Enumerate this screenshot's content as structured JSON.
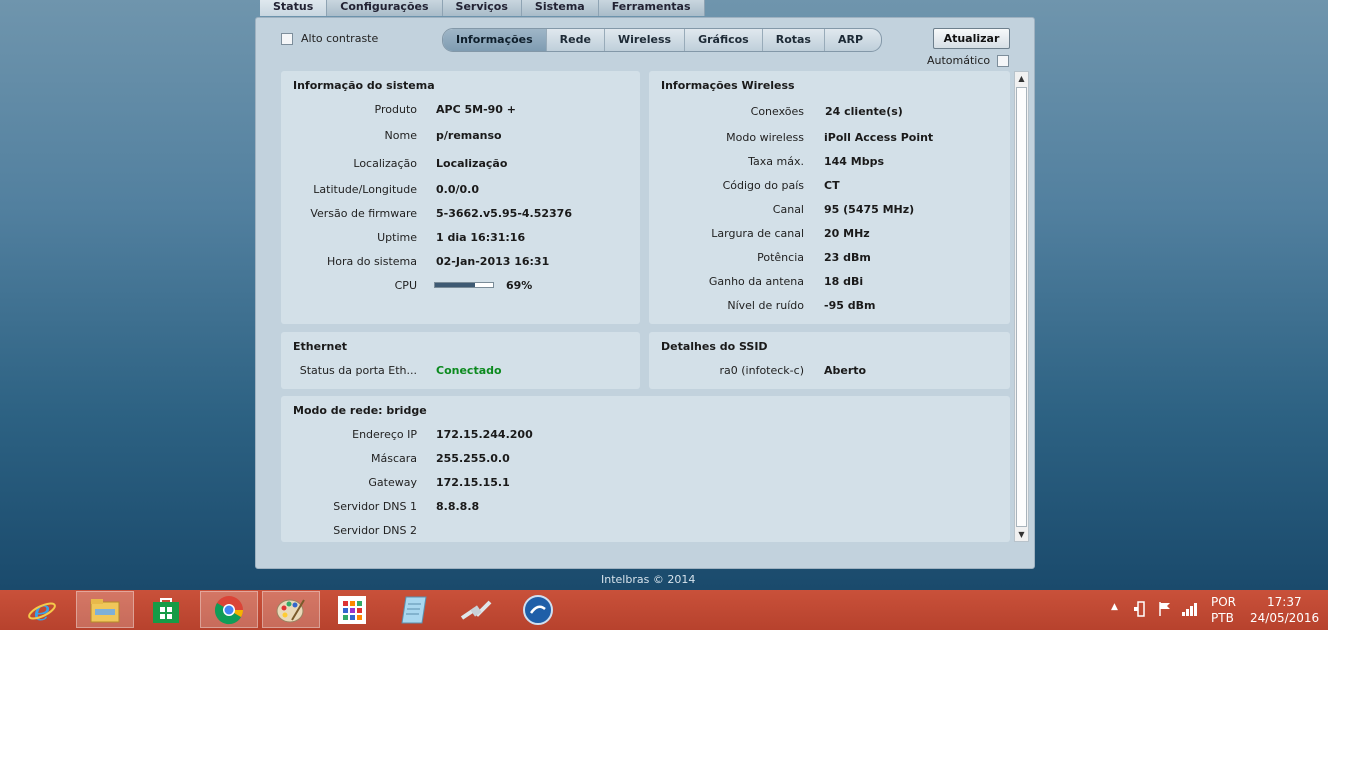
{
  "main_tabs": [
    {
      "label": "Status",
      "active": true
    },
    {
      "label": "Configurações",
      "active": false
    },
    {
      "label": "Serviços",
      "active": false
    },
    {
      "label": "Sistema",
      "active": false
    },
    {
      "label": "Ferramentas",
      "active": false
    }
  ],
  "toolbar": {
    "contrast_label": "Alto contraste",
    "update_button": "Atualizar",
    "auto_label": "Automático"
  },
  "sub_tabs": [
    {
      "label": "Informações",
      "active": true
    },
    {
      "label": "Rede",
      "active": false
    },
    {
      "label": "Wireless",
      "active": false
    },
    {
      "label": "Gráficos",
      "active": false
    },
    {
      "label": "Rotas",
      "active": false
    },
    {
      "label": "ARP",
      "active": false
    }
  ],
  "system_info": {
    "title": "Informação do sistema",
    "rows": [
      {
        "key": "Produto",
        "value": "APC 5M-90 +"
      },
      {
        "key": "Nome",
        "value": "p/remanso"
      },
      {
        "key": "Localização",
        "value": "Localização"
      },
      {
        "key": "Latitude/Longitude",
        "value": "0.0/0.0"
      },
      {
        "key": "Versão de firmware",
        "value": "5-3662.v5.95-4.52376"
      },
      {
        "key": "Uptime",
        "value": "1 dia 16:31:16"
      },
      {
        "key": "Hora do sistema",
        "value": "02-Jan-2013 16:31"
      },
      {
        "key": "CPU",
        "value": "69%"
      }
    ],
    "cpu_fraction": 0.69
  },
  "wireless_info": {
    "title": "Informações Wireless",
    "rows": [
      {
        "key": "Conexões",
        "value": "24 cliente(s)"
      },
      {
        "key": "Modo wireless",
        "value": "iPoll Access Point"
      },
      {
        "key": "Taxa máx.",
        "value": "144 Mbps"
      },
      {
        "key": "Código do país",
        "value": "CT"
      },
      {
        "key": "Canal",
        "value": "95 (5475 MHz)"
      },
      {
        "key": "Largura de canal",
        "value": "20 MHz"
      },
      {
        "key": "Potência",
        "value": "23 dBm"
      },
      {
        "key": "Ganho da antena",
        "value": "18 dBi"
      },
      {
        "key": "Nível de ruído",
        "value": "-95 dBm"
      }
    ]
  },
  "ethernet": {
    "title": "Ethernet",
    "key": "Status da porta Eth...",
    "value": "Conectado",
    "status_color": "#0c8a1f"
  },
  "ssid": {
    "title": "Detalhes do SSID",
    "key": "ra0 (infoteck-c)",
    "value": "Aberto"
  },
  "network": {
    "title": "Modo de rede: bridge",
    "rows": [
      {
        "key": "Endereço IP",
        "value": "172.15.244.200"
      },
      {
        "key": "Máscara",
        "value": "255.255.0.0"
      },
      {
        "key": "Gateway",
        "value": "172.15.15.1"
      },
      {
        "key": "Servidor DNS 1",
        "value": "8.8.8.8"
      },
      {
        "key": "Servidor DNS 2",
        "value": ""
      }
    ]
  },
  "footer": "Intelbras © 2014",
  "taskbar": {
    "apps": [
      {
        "icon": "internet-explorer-icon",
        "active": false
      },
      {
        "icon": "file-explorer-icon",
        "active": true
      },
      {
        "icon": "store-icon",
        "active": false
      },
      {
        "icon": "chrome-icon",
        "active": true
      },
      {
        "icon": "paint-icon",
        "active": true
      },
      {
        "icon": "apps-grid-icon",
        "active": false
      },
      {
        "icon": "notepad-icon",
        "active": false
      },
      {
        "icon": "network-cable-icon",
        "active": false
      },
      {
        "icon": "winbox-icon",
        "active": false
      }
    ],
    "lang_top": "POR",
    "lang_bottom": "PTB",
    "time": "17:37",
    "date": "24/05/2016"
  }
}
